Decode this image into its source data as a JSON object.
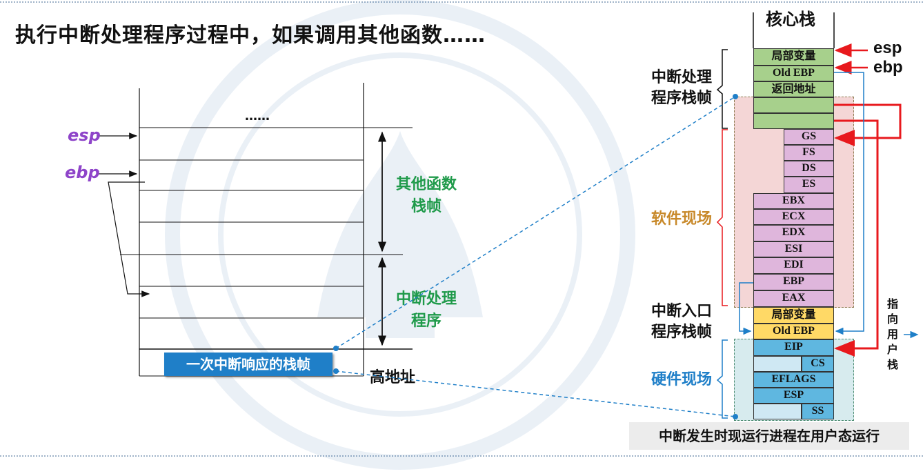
{
  "title": "执行中断处理程序过程中，如果调用其他函数……",
  "left": {
    "dots": "……",
    "esp": "esp",
    "ebp": "ebp",
    "other_frame": [
      "其他函数",
      "栈帧"
    ],
    "intr_prog": [
      "中断处理",
      "程序"
    ],
    "frame_button": "一次中断响应的栈帧",
    "high_addr": "高地址"
  },
  "right": {
    "stack_title": "核心栈",
    "esp": "esp",
    "ebp": "ebp",
    "cells": {
      "local_var_top": "局部变量",
      "old_ebp_top": "Old EBP",
      "ret_addr": "返回地址",
      "gs": "GS",
      "fs": "FS",
      "ds": "DS",
      "es": "ES",
      "ebx": "EBX",
      "ecx": "ECX",
      "edx": "EDX",
      "esi": "ESI",
      "edi": "EDI",
      "ebp": "EBP",
      "eax": "EAX",
      "local_var_entry": "局部变量",
      "old_ebp_entry": "Old EBP",
      "eip": "EIP",
      "cs": "CS",
      "eflags": "EFLAGS",
      "esp": "ESP",
      "ss": "SS"
    },
    "intr_handler_frame": [
      "中断处理",
      "程序栈帧"
    ],
    "software_ctx": "软件现场",
    "intr_entry_frame": [
      "中断入口",
      "程序栈帧"
    ],
    "hardware_ctx": "硬件现场",
    "user_stack_pointer": [
      "指",
      "向",
      "用",
      "户",
      "栈"
    ],
    "caption": "中断发生时现运行进程在用户态运行"
  },
  "colors": {
    "green": "#a7d08c",
    "pink": "#dfb6dc",
    "yellow": "#ffd966",
    "blue": "#5fb7e0",
    "lightblue": "#cfe8f3",
    "arrow_red": "#e8191d",
    "arrow_blue": "#1f7fc8",
    "software_bg": "#f4d6d6",
    "hardware_bg": "#d7ebee"
  }
}
